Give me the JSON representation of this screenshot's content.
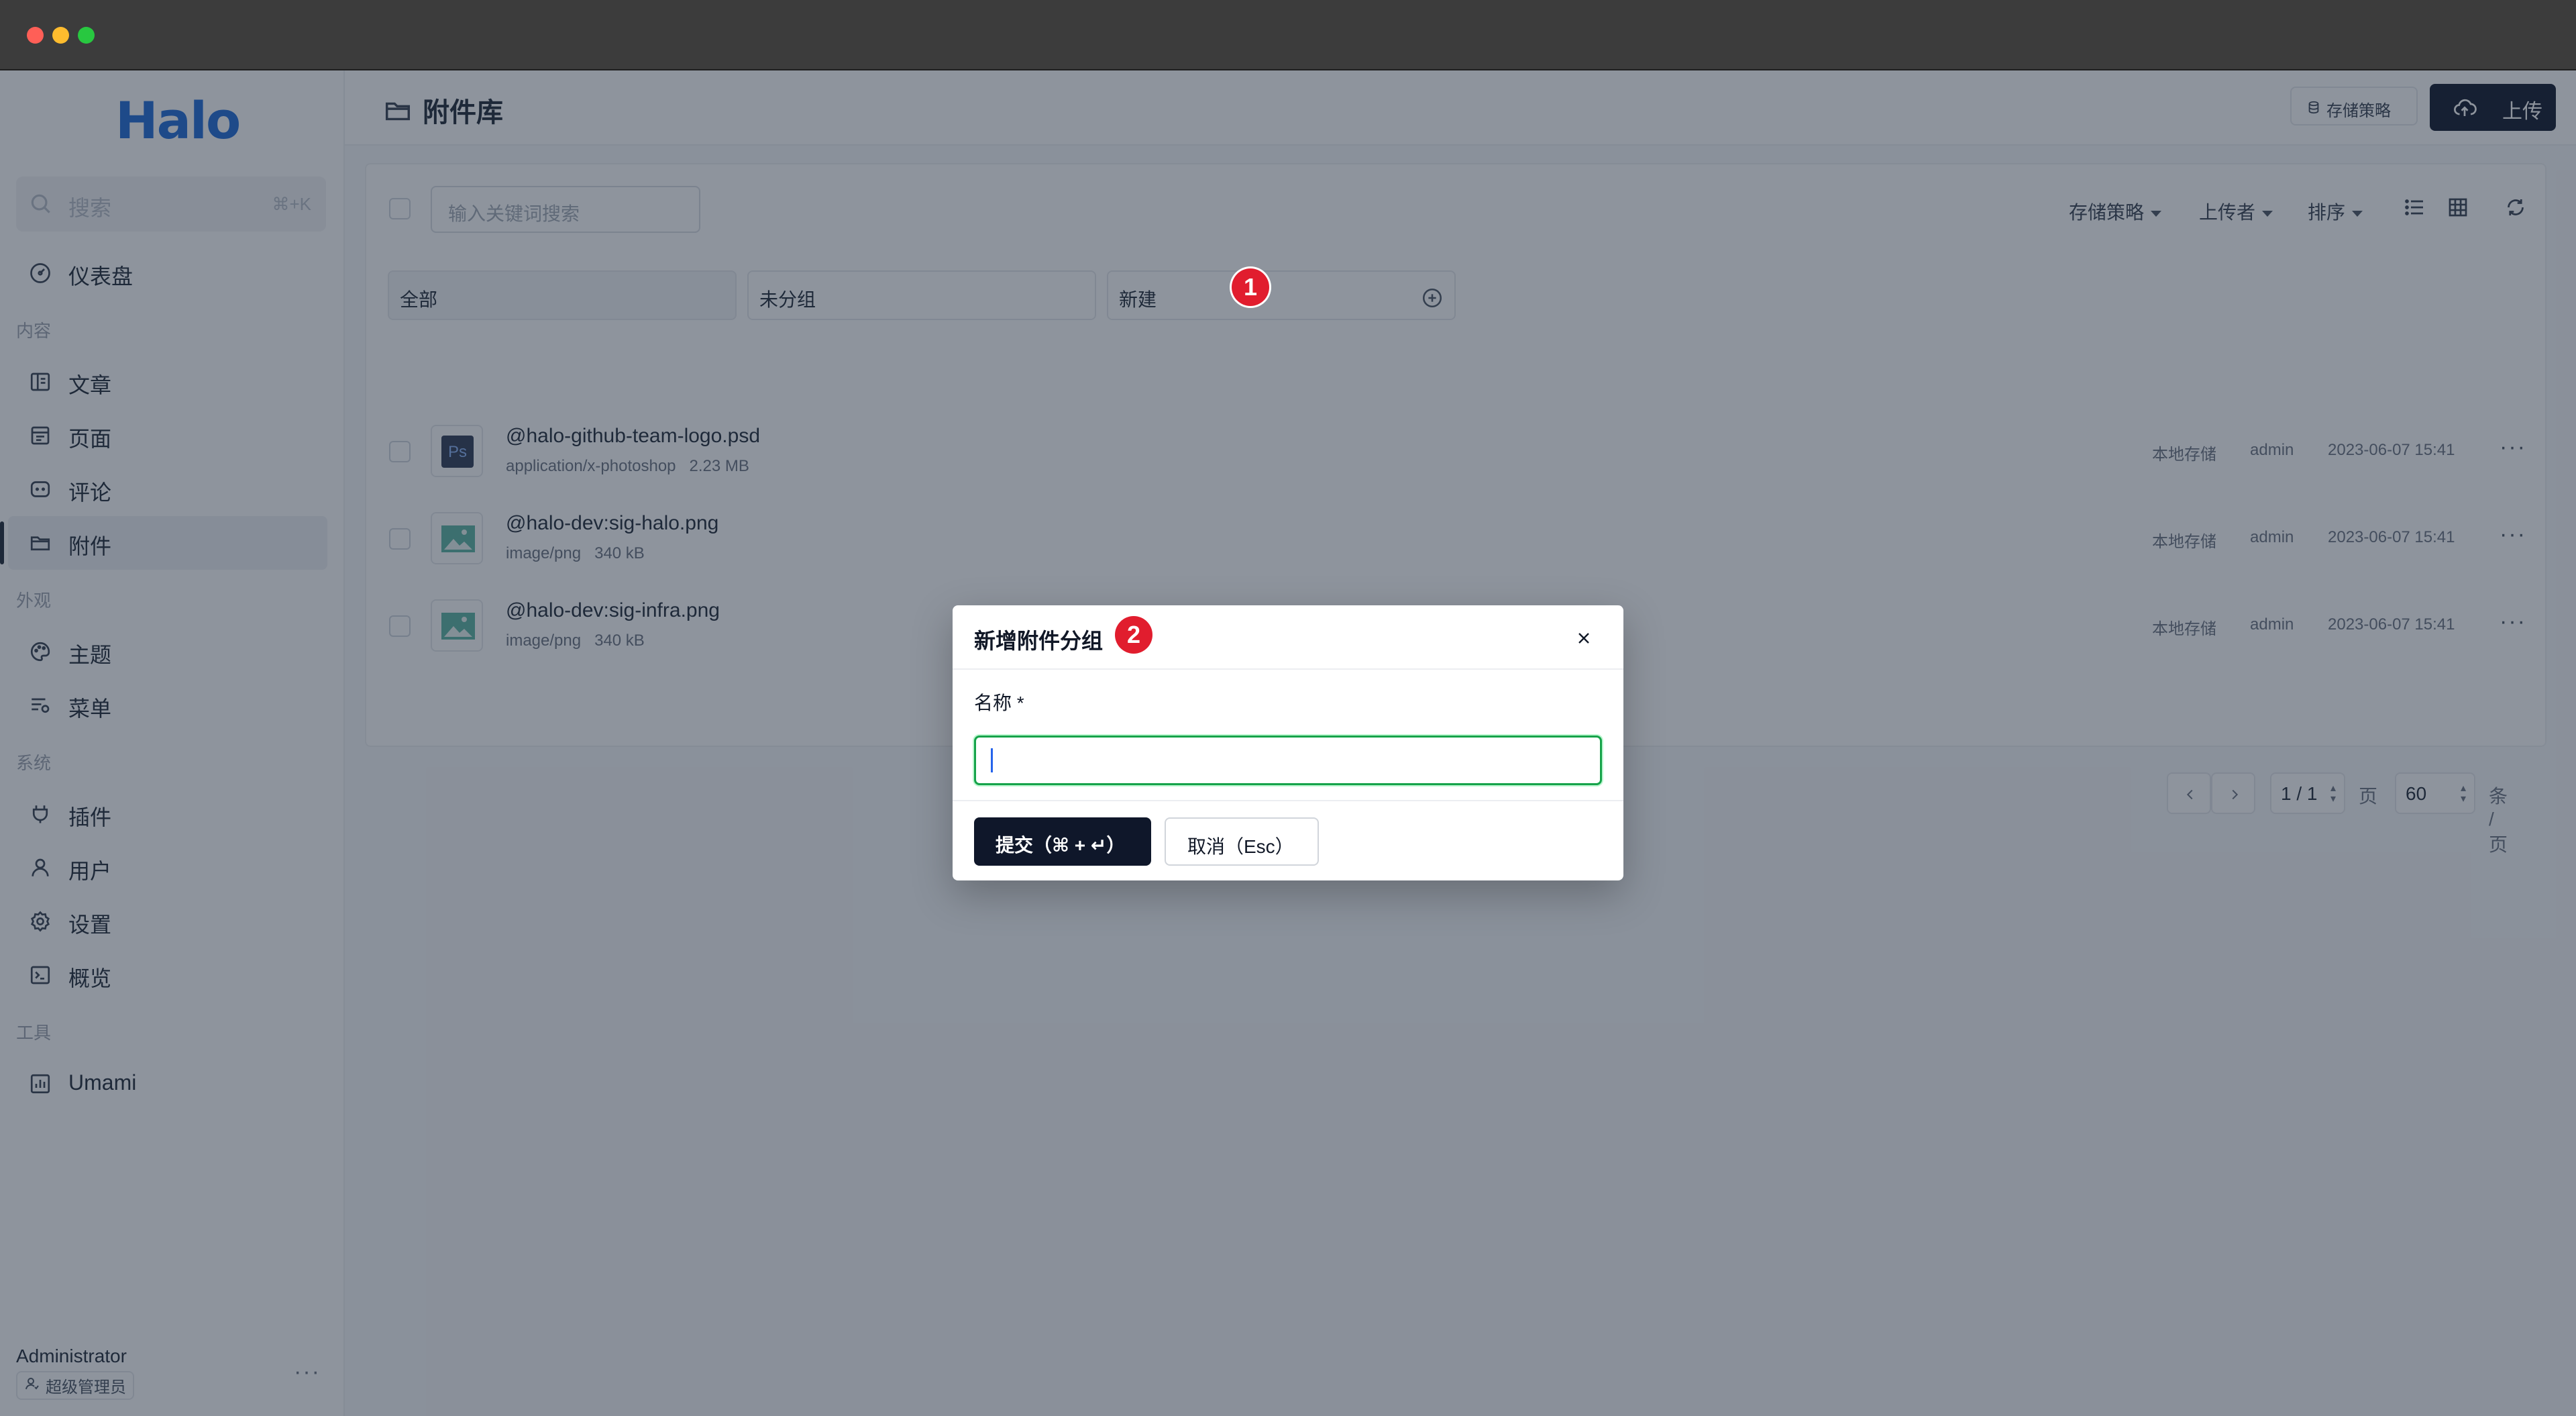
{
  "window": {
    "traffic_lights": [
      "#ff5f57",
      "#febc2e",
      "#28c840"
    ]
  },
  "sidebar": {
    "logo": "Halo",
    "search_placeholder": "搜索",
    "search_shortcut": "⌘+K",
    "dashboard": "仪表盘",
    "sections": {
      "content": "内容",
      "appearance": "外观",
      "system": "系统",
      "tools": "工具"
    },
    "items": {
      "posts": "文章",
      "pages": "页面",
      "comments": "评论",
      "attachments": "附件",
      "themes": "主题",
      "menus": "菜单",
      "plugins": "插件",
      "users": "用户",
      "settings": "设置",
      "overview": "概览",
      "umami": "Umami"
    },
    "active_item": "attachments",
    "user": {
      "name": "Administrator",
      "role": "超级管理员"
    }
  },
  "header": {
    "title": "附件库",
    "policy_button": "存储策略",
    "upload_button": "上传"
  },
  "toolbar": {
    "keyword_placeholder": "输入关键词搜索",
    "filter_policy": "存储策略",
    "filter_uploader": "上传者",
    "filter_sort": "排序"
  },
  "groups": {
    "all": "全部",
    "ungrouped": "未分组",
    "new": "新建"
  },
  "attachments": [
    {
      "name": "@halo-github-team-logo.psd",
      "mime": "application/x-photoshop",
      "size": "2.23 MB",
      "policy": "本地存储",
      "owner": "admin",
      "time": "2023-06-07 15:41",
      "thumb": "photoshop-icon"
    },
    {
      "name": "@halo-dev:sig-halo.png",
      "mime": "image/png",
      "size": "340 kB",
      "policy": "本地存储",
      "owner": "admin",
      "time": "2023-06-07 15:41",
      "thumb": "image-icon"
    },
    {
      "name": "@halo-dev:sig-infra.png",
      "mime": "image/png",
      "size": "340 kB",
      "policy": "本地存储",
      "owner": "admin",
      "time": "2023-06-07 15:41",
      "thumb": "image-icon"
    }
  ],
  "pagination": {
    "page": "1 / 1",
    "page_unit": "页",
    "size": "60",
    "size_unit": "条 / 页"
  },
  "modal": {
    "title": "新增附件分组",
    "name_label": "名称 *",
    "name_value": "",
    "submit": "提交（⌘ + ↵）",
    "cancel": "取消（Esc）"
  },
  "annotations": {
    "badge1": "1",
    "badge2": "2",
    "color": "#e11d2e"
  }
}
